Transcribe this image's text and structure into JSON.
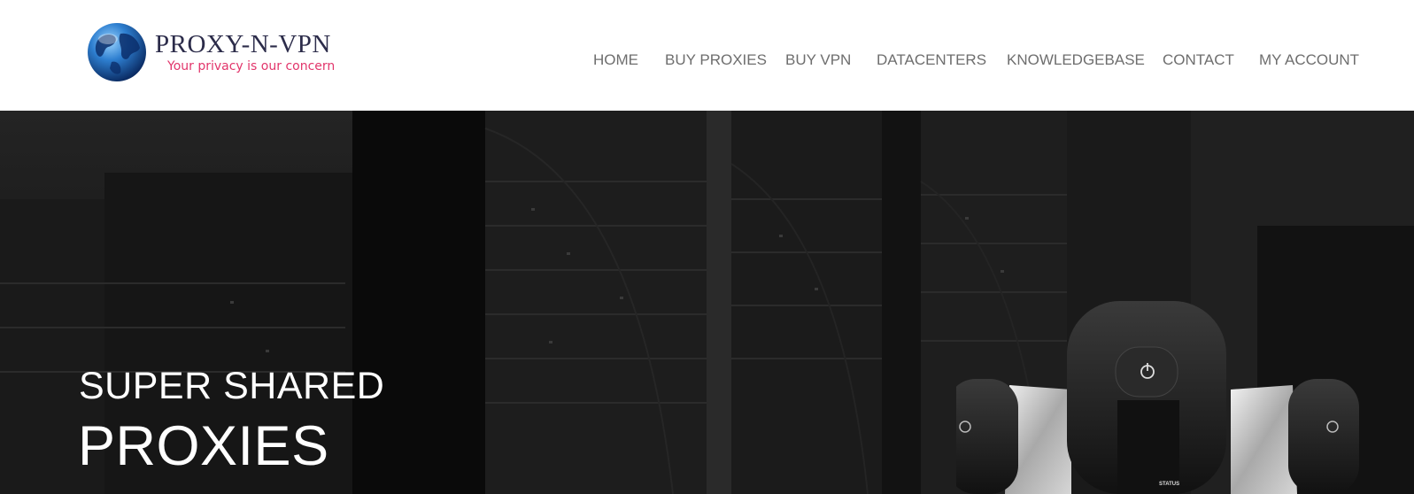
{
  "header": {
    "logo": {
      "name": "PROXY-N-VPN",
      "tagline": "Your privacy is our concern",
      "icon": "globe-icon"
    },
    "nav": [
      {
        "label": "HOME"
      },
      {
        "label": "BUY PROXIES"
      },
      {
        "label": "BUY VPN"
      },
      {
        "label": "DATACENTERS"
      },
      {
        "label": "KNOWLEDGEBASE"
      },
      {
        "label": "CONTACT"
      },
      {
        "label": "MY ACCOUNT"
      }
    ]
  },
  "hero": {
    "title_line1": "SUPER SHARED",
    "title_line2": "PROXIES",
    "device_status_label": "STATUS",
    "background": "server-room-image"
  },
  "colors": {
    "nav_text": "#6e6e6e",
    "tagline": "#e2356b",
    "logo_text": "#2c2c4a",
    "hero_text": "#ffffff"
  }
}
